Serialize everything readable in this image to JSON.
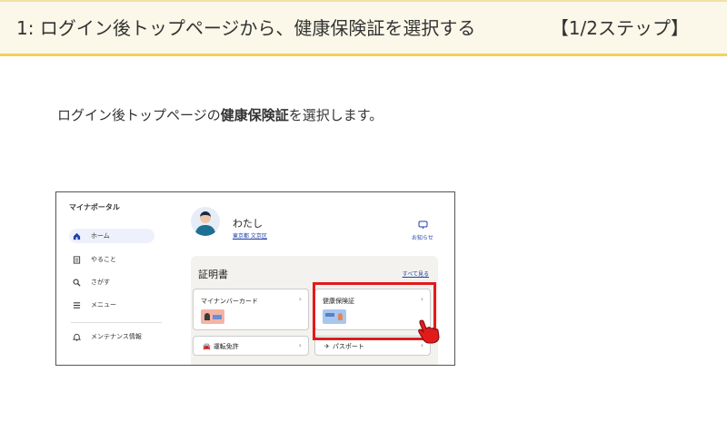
{
  "header": {
    "title": "1: ログイン後トップページから、健康保険証を選択する",
    "step_counter": "【1/2ステップ】"
  },
  "lead": {
    "prefix": "ログイン後トップページの",
    "emphasis": "健康保険証",
    "suffix": "を選択します。"
  },
  "portal": {
    "brand": "マイナポータル",
    "nav": [
      {
        "label": "ホーム",
        "icon": "home-icon",
        "active": true
      },
      {
        "label": "やること",
        "icon": "checklist-icon"
      },
      {
        "label": "さがす",
        "icon": "search-icon"
      },
      {
        "label": "メニュー",
        "icon": "menu-icon"
      },
      {
        "label": "メンテナンス情報",
        "icon": "bell-icon"
      }
    ],
    "user": {
      "name": "わたし",
      "address": "東京都 文京区"
    },
    "notice_label": "お知らせ",
    "certificates": {
      "title": "証明書",
      "see_all": "すべて見る",
      "cards": [
        {
          "label": "マイナンバーカード"
        },
        {
          "label": "健康保険証"
        },
        {
          "label": "運転免許"
        },
        {
          "label": "パスポート"
        }
      ]
    },
    "colors": {
      "highlight": "#e11b1b",
      "link": "#1d3fa8",
      "header_border": "#f0d25c"
    }
  }
}
